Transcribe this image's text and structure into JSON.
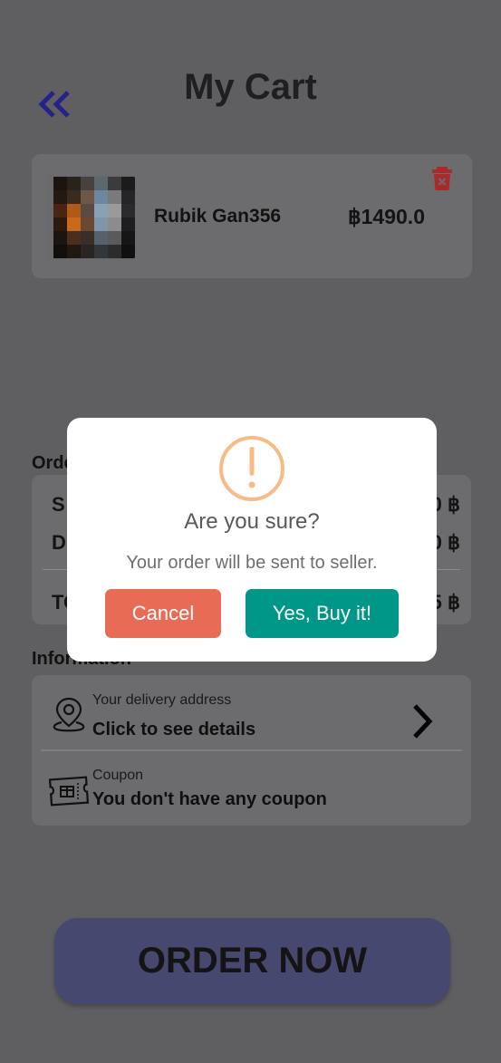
{
  "header": {
    "title": "My Cart",
    "back_icon": "double-chevron-left-icon"
  },
  "cart": {
    "items": [
      {
        "name": "Rubik Gan356",
        "price": "฿1490.0",
        "image": "product-thumbnail-pixelated",
        "delete_icon": "trash-icon"
      }
    ]
  },
  "summary": {
    "section_label": "Orde",
    "rows": [
      {
        "label": "S",
        "value": "0 ฿"
      },
      {
        "label": "D",
        "value": "0 ฿"
      },
      {
        "label": "TO",
        "value": "5 ฿"
      }
    ]
  },
  "information": {
    "section_label": "Information",
    "delivery": {
      "small": "Your delivery address",
      "big": "Click to see details",
      "icon": "location-pin-icon",
      "action_icon": "chevron-right-icon"
    },
    "coupon": {
      "small": "Coupon",
      "big": "You don't have any coupon",
      "icon": "coupon-ticket-icon"
    }
  },
  "order_button": {
    "label": "ORDER NOW"
  },
  "dialog": {
    "icon": "exclamation-circle-icon",
    "title": "Are you sure?",
    "text": "Your order will be sent to seller.",
    "cancel_label": "Cancel",
    "confirm_label": "Yes, Buy it!"
  },
  "colors": {
    "overlay_background": "#5f5f62",
    "card": "#6c6c6f",
    "trash": "#a82a2a",
    "back_arrow": "#23238a",
    "order_button": "#464870",
    "warning": "#f8bb86",
    "cancel": "#e86b56",
    "confirm": "#009688"
  }
}
